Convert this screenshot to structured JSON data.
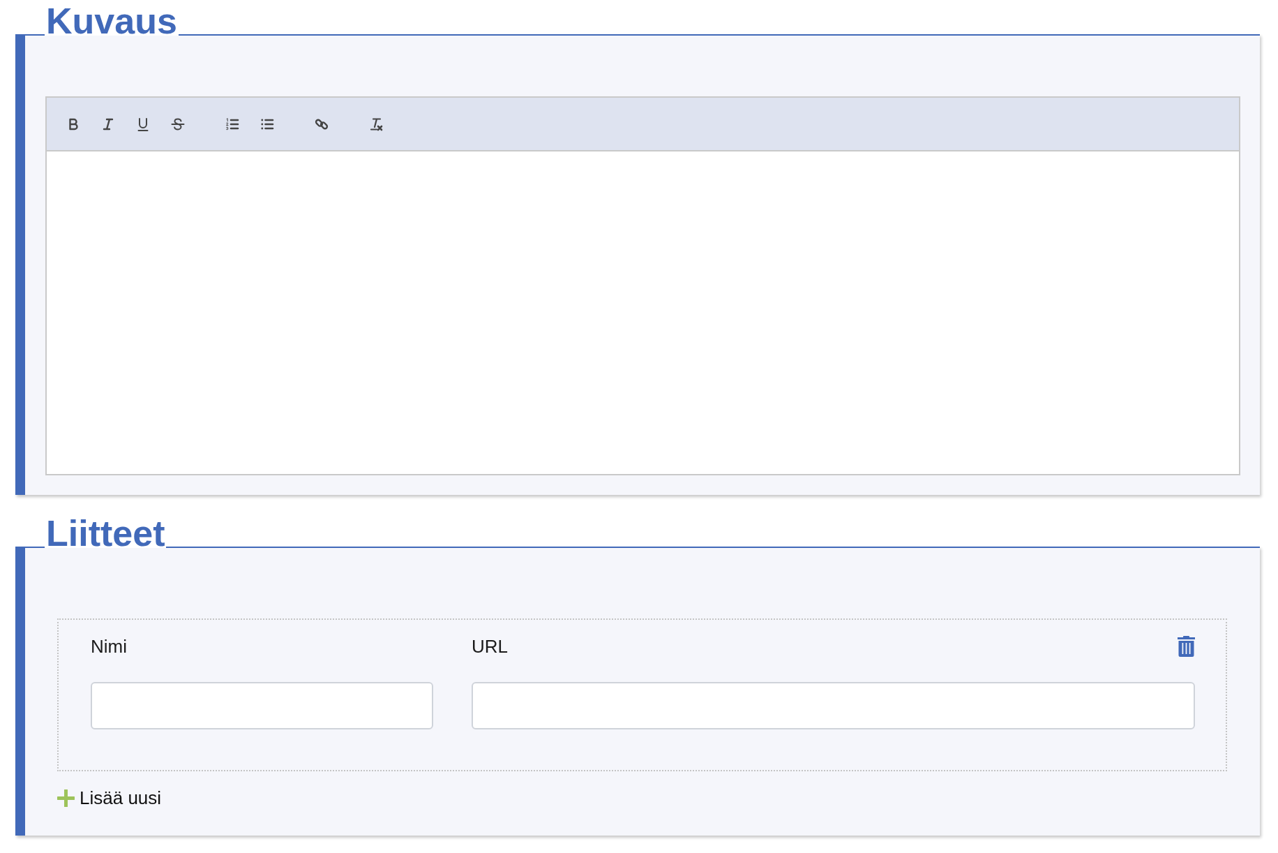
{
  "sections": [
    {
      "kind": "editor",
      "title": "Kuvaus"
    },
    {
      "kind": "attachments",
      "title": "Liitteet",
      "items": [
        {
          "fields": [
            {
              "label": "Nimi"
            },
            {
              "label": "URL"
            }
          ]
        }
      ],
      "add_label": "Lisää uusi"
    }
  ]
}
